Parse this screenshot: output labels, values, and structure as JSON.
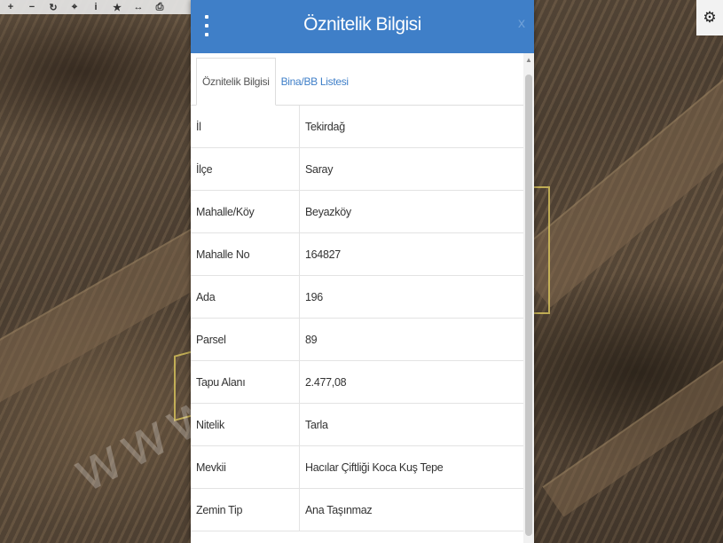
{
  "toolbar": {
    "tools": [
      {
        "icon": "zoom-in-icon",
        "glyph": "+"
      },
      {
        "icon": "zoom-out-icon",
        "glyph": "−"
      },
      {
        "icon": "refresh-icon",
        "glyph": "↻"
      },
      {
        "icon": "locate-icon",
        "glyph": "⌖"
      },
      {
        "icon": "info-icon",
        "glyph": "i"
      },
      {
        "icon": "star-icon",
        "glyph": "★"
      },
      {
        "icon": "measure-icon",
        "glyph": "↔"
      },
      {
        "icon": "print-icon",
        "glyph": "⎙"
      }
    ]
  },
  "settings_icon": "⚙",
  "watermark": "www.",
  "panel": {
    "title": "Öznitelik Bilgisi",
    "close": "x",
    "tabs": [
      {
        "label": "Öznitelik Bilgisi",
        "active": true
      },
      {
        "label": "Bina/BB Listesi",
        "active": false
      }
    ],
    "rows": [
      {
        "key": "İl",
        "value": "Tekirdağ"
      },
      {
        "key": "İlçe",
        "value": "Saray"
      },
      {
        "key": "Mahalle/Köy",
        "value": "Beyazköy"
      },
      {
        "key": "Mahalle No",
        "value": "164827"
      },
      {
        "key": "Ada",
        "value": "196"
      },
      {
        "key": "Parsel",
        "value": "89"
      },
      {
        "key": "Tapu Alanı",
        "value": "2.477,08"
      },
      {
        "key": "Nitelik",
        "value": "Tarla"
      },
      {
        "key": "Mevkii",
        "value": "Hacılar Çiftliği Koca Kuş Tepe"
      },
      {
        "key": "Zemin Tip",
        "value": "Ana Taşınmaz"
      }
    ]
  },
  "colors": {
    "header": "#3f7fc8",
    "tab_link": "#3f7fc8",
    "parcel_outline": "#d2be5a"
  }
}
